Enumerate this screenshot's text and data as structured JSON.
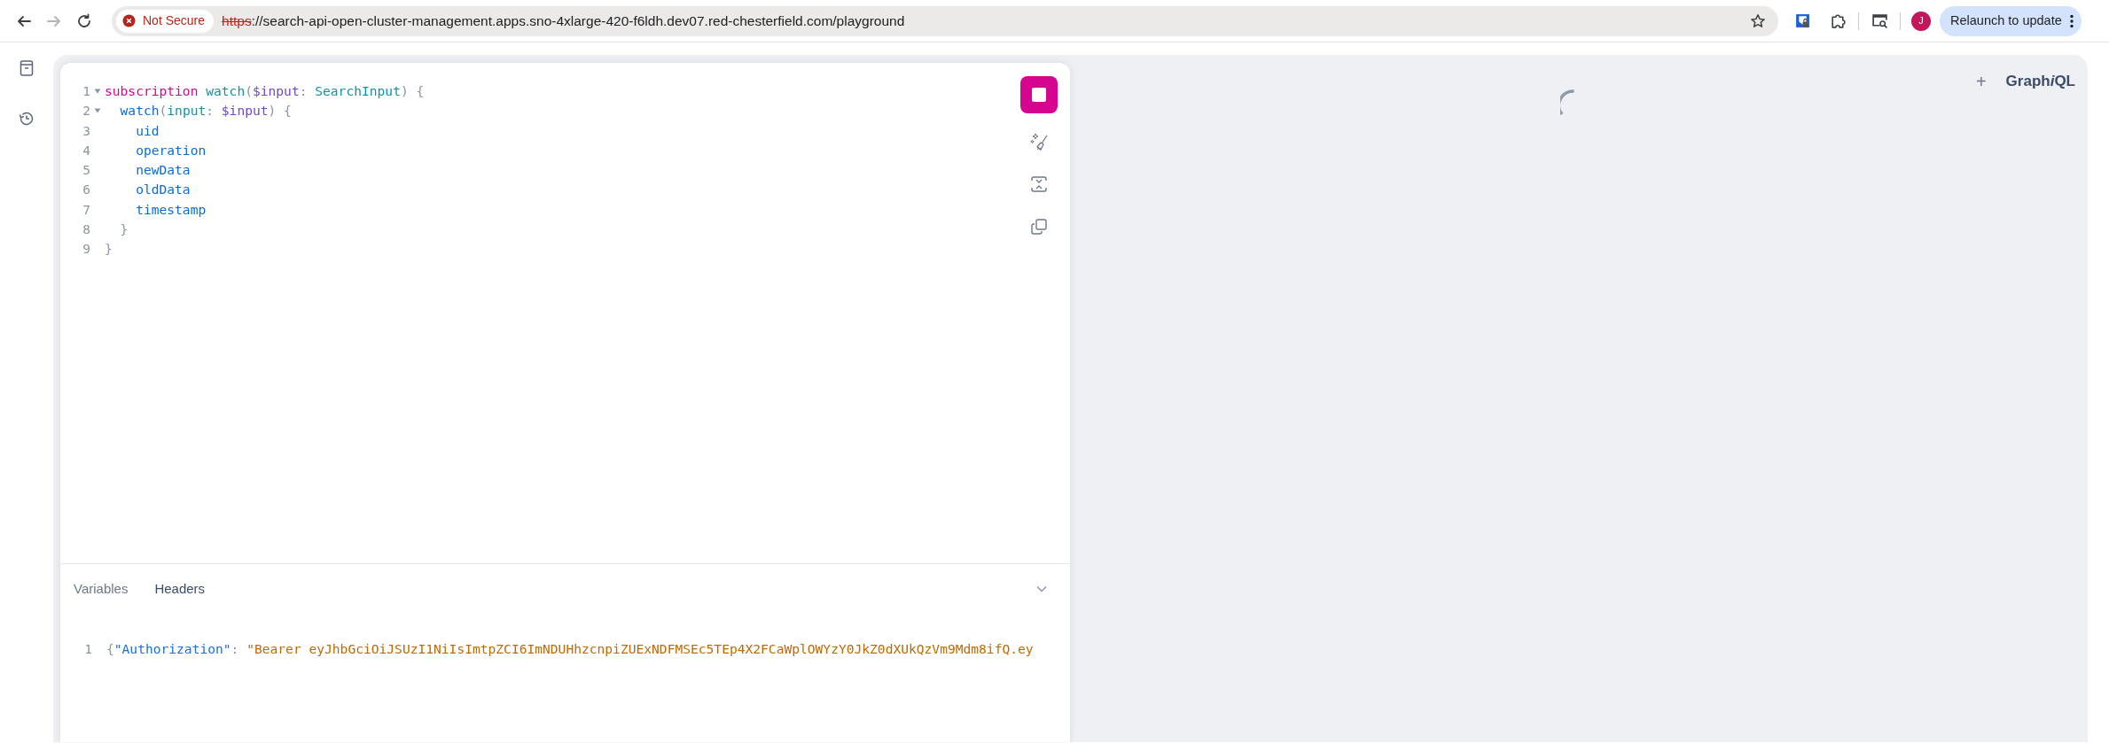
{
  "browser": {
    "nav": [
      {
        "kind": "back",
        "disabled": false
      },
      {
        "kind": "forward",
        "disabled": true
      },
      {
        "kind": "reload",
        "disabled": false
      }
    ],
    "security_chip": "Not Secure",
    "url": {
      "scheme": "https",
      "rest": "://search-api-open-cluster-management.apps.sno-4xlarge-420-f6ldh.dev07.red-chesterfield.com/playground"
    },
    "extensions": [
      {
        "kind": "lock-shield"
      },
      {
        "kind": "puzzle"
      },
      {
        "kind": "screen-search"
      }
    ],
    "profile_initial": "J",
    "update_button": "Relaunch to update"
  },
  "sidebar": {
    "items": [
      {
        "kind": "docs",
        "selected": false
      },
      {
        "kind": "history",
        "selected": false
      }
    ]
  },
  "editor": {
    "running": true,
    "tools": [
      {
        "kind": "prettify"
      },
      {
        "kind": "merge"
      },
      {
        "kind": "copy"
      }
    ],
    "lines": [
      {
        "number": "1",
        "foldable": true,
        "tokens": [
          {
            "kind": "keyword",
            "text": "subscription "
          },
          {
            "kind": "def",
            "text": "watch"
          },
          {
            "kind": "punct",
            "text": "("
          },
          {
            "kind": "variable",
            "text": "$input"
          },
          {
            "kind": "punct",
            "text": ": "
          },
          {
            "kind": "type",
            "text": "SearchInput"
          },
          {
            "kind": "punct",
            "text": ") {"
          }
        ]
      },
      {
        "number": "2",
        "foldable": true,
        "tokens": [
          {
            "kind": "field",
            "text": "  watch"
          },
          {
            "kind": "punct",
            "text": "("
          },
          {
            "kind": "argument",
            "text": "input"
          },
          {
            "kind": "punct",
            "text": ": "
          },
          {
            "kind": "variable",
            "text": "$input"
          },
          {
            "kind": "punct",
            "text": ") {"
          }
        ]
      },
      {
        "number": "3",
        "foldable": false,
        "tokens": [
          {
            "kind": "field",
            "text": "    uid"
          }
        ]
      },
      {
        "number": "4",
        "foldable": false,
        "tokens": [
          {
            "kind": "field",
            "text": "    operation"
          }
        ]
      },
      {
        "number": "5",
        "foldable": false,
        "tokens": [
          {
            "kind": "field",
            "text": "    newData"
          }
        ]
      },
      {
        "number": "6",
        "foldable": false,
        "tokens": [
          {
            "kind": "field",
            "text": "    oldData"
          }
        ]
      },
      {
        "number": "7",
        "foldable": false,
        "tokens": [
          {
            "kind": "field",
            "text": "    timestamp"
          }
        ]
      },
      {
        "number": "8",
        "foldable": false,
        "tokens": [
          {
            "kind": "punct",
            "text": "  }"
          }
        ]
      },
      {
        "number": "9",
        "foldable": false,
        "tokens": [
          {
            "kind": "punct",
            "text": "}"
          }
        ]
      }
    ]
  },
  "bottom_tabs": [
    {
      "label": "Variables",
      "selected": false
    },
    {
      "label": "Headers",
      "selected": true
    }
  ],
  "headers_editor": {
    "lines": [
      {
        "number": "1",
        "foldable": false,
        "tokens": [
          {
            "kind": "punct",
            "text": "{"
          },
          {
            "kind": "property",
            "text": "\"Authorization\""
          },
          {
            "kind": "punct",
            "text": ": "
          },
          {
            "kind": "string",
            "text": "\"Bearer eyJhbGciOiJSUzI1NiIsImtpZCI6ImNDUHhzcnpiZUExNDFMSEc5TEp4X2FCaWplOWYzY0JkZ0dXUkQzVm9Mdm8ifQ.ey"
          }
        ]
      }
    ]
  },
  "results": {
    "loading": true
  },
  "top_right": {
    "add": "+",
    "logo": [
      {
        "text": "Graph",
        "italic": false
      },
      {
        "text": "i",
        "italic": true
      },
      {
        "text": "QL",
        "italic": false
      }
    ]
  }
}
